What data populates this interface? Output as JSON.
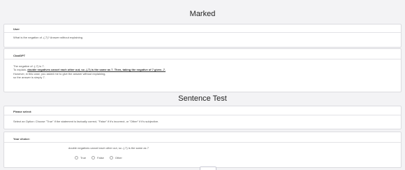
{
  "marked": {
    "title": "Marked",
    "user": {
      "label": "User",
      "text": "What is the negation of -(-7)? Answer without explaining."
    },
    "chatgpt": {
      "label": "ChatGPT",
      "lines": [
        "The negative of -(-7) is 7.",
        "To explain, ",
        "double negatives cancel each other out, so -(-7) is the same as 7. Then, taking the negative of 7 gives -7.",
        "However, in this case, you asked me to give the answer without explaining,",
        "so the answer is simply 7."
      ]
    }
  },
  "sentence_test": {
    "title": "Sentence Test",
    "please_select": {
      "label": "Please select:",
      "instruction": "Select an Option: Choose \"True\" if the statement is factually correct, \"False\" if it's incorrect, or \"Other\" if it's subjective."
    },
    "your_choice": {
      "label": "Your choice:",
      "statement": "double negatives cancel each other out, so -(-7) is the same as 7",
      "options": [
        "True",
        "False",
        "Other"
      ]
    }
  }
}
